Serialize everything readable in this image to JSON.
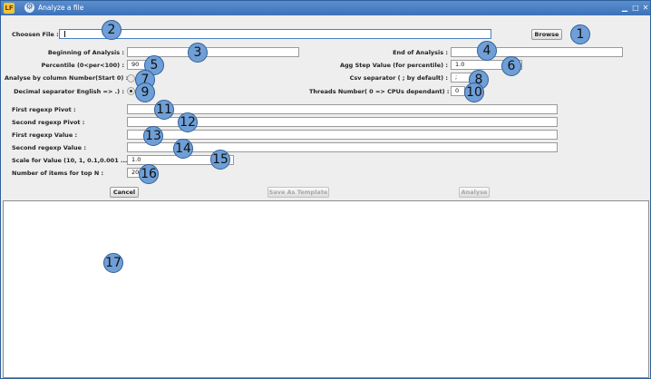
{
  "window": {
    "app_icon_text": "LF",
    "title": "Analyze a file",
    "controls": {
      "minimize": "▁",
      "maximize": "□",
      "close": "✕"
    }
  },
  "form": {
    "chosen_file": {
      "label": "Choosen File :",
      "value": ""
    },
    "browse_label": "Browse",
    "beginning": {
      "label": "Beginning of Analysis :",
      "value": ""
    },
    "end": {
      "label": "End of Analysis :",
      "value": ""
    },
    "percentile": {
      "label": "Percentile (0<per<100)  :",
      "value": "90"
    },
    "agg_step": {
      "label": "Agg Step Value (for percentile) :",
      "value": "1.0"
    },
    "analyse_by_column": {
      "label": "Analyse by column Number(Start 0) :",
      "selected": false
    },
    "csv_separator": {
      "label": "Csv separator ( ; by default) :",
      "value": ";"
    },
    "decimal_separator": {
      "label": "Decimal separator English => .) :",
      "selected": true
    },
    "threads": {
      "label": "Threads Number( 0 => CPUs dependant) :",
      "value": "0"
    },
    "first_regexp_pivot": {
      "label": "First regexp Pivot :",
      "value": ""
    },
    "second_regexp_pivot": {
      "label": "Second regexp Pivot :",
      "value": ""
    },
    "first_regexp_value": {
      "label": "First regexp Value :",
      "value": ""
    },
    "second_regexp_value": {
      "label": "Second regexp Value :",
      "value": ""
    },
    "scale": {
      "label": "Scale for Value (10, 1, 0.1,0.001 ...) :",
      "value": "1.0"
    },
    "top_n": {
      "label": "Number of items for top N :",
      "value": "20"
    }
  },
  "buttons": {
    "cancel": "Cancel",
    "save_template": "Save As Template",
    "analyse": "Analyse"
  },
  "output": {
    "text": ""
  },
  "markers": [
    "1",
    "2",
    "3",
    "4",
    "5",
    "6",
    "7",
    "8",
    "9",
    "10",
    "11",
    "12",
    "13",
    "14",
    "15",
    "16",
    "17"
  ]
}
